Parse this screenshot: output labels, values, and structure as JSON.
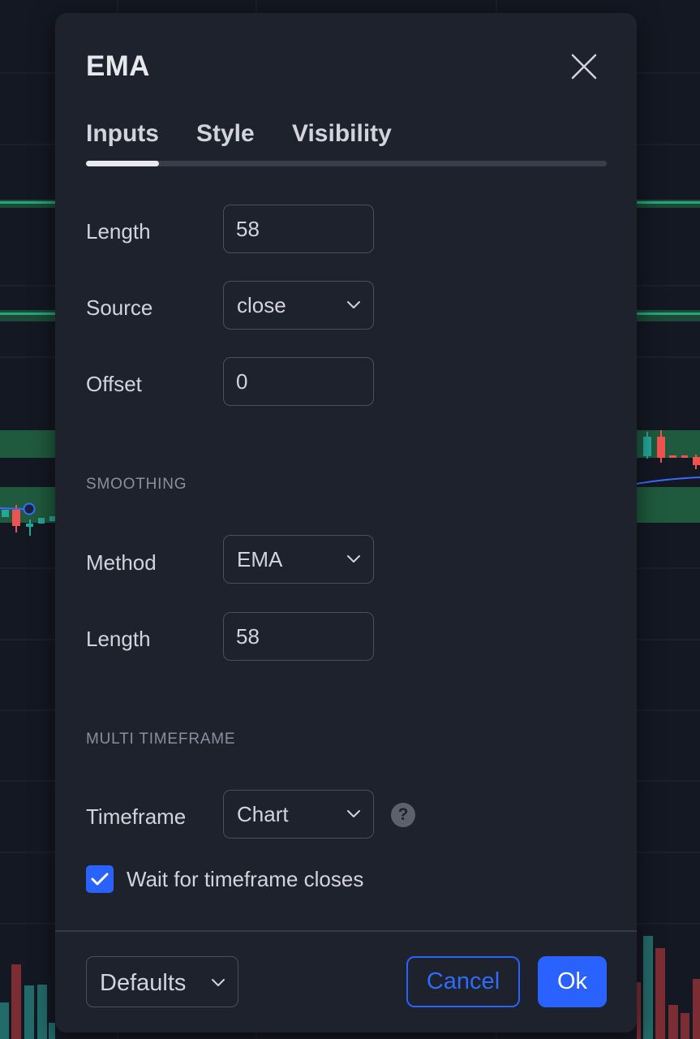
{
  "dialog": {
    "title": "EMA",
    "tabs": [
      "Inputs",
      "Style",
      "Visibility"
    ],
    "active_tab": "Inputs"
  },
  "inputs": {
    "length_label": "Length",
    "length_value": "58",
    "source_label": "Source",
    "source_value": "close",
    "offset_label": "Offset",
    "offset_value": "0"
  },
  "smoothing": {
    "heading": "SMOOTHING",
    "method_label": "Method",
    "method_value": "EMA",
    "length_label": "Length",
    "length_value": "58"
  },
  "multi_timeframe": {
    "heading": "MULTI TIMEFRAME",
    "timeframe_label": "Timeframe",
    "timeframe_value": "Chart",
    "help_glyph": "?",
    "wait_checkbox_label": "Wait for timeframe closes",
    "wait_checked": true
  },
  "footer": {
    "defaults_label": "Defaults",
    "cancel_label": "Cancel",
    "ok_label": "Ok"
  },
  "colors": {
    "dialog_bg": "#1e222d",
    "accent": "#2962ff",
    "up_candle": "#26a69a",
    "down_candle": "#ef5350",
    "zone_fill": "#1f5a3e"
  },
  "icons": [
    "close-icon",
    "chevron-down-icon",
    "help-icon",
    "checkmark-icon"
  ]
}
